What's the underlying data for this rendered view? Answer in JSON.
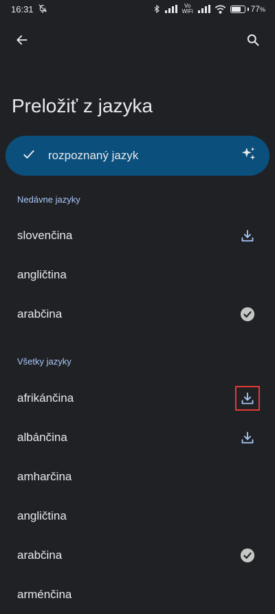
{
  "status": {
    "time": "16:31",
    "battery": "77",
    "battery_unit": "%",
    "battery_level": 0.77,
    "network_label": "Vo WiFi"
  },
  "toolbar": {
    "back_icon": "arrow-back-icon",
    "search_icon": "search-icon"
  },
  "page_title": "Preložiť z jazyka",
  "detected": {
    "label": "rozpoznaný jazyk",
    "check_icon": "check-icon",
    "sparkle_icon": "sparkle-icon"
  },
  "recent": {
    "header": "Nedávne jazyky",
    "items": [
      {
        "name": "slovenčina",
        "status": "download"
      },
      {
        "name": "angličtina",
        "status": "none"
      },
      {
        "name": "arabčina",
        "status": "downloaded"
      }
    ]
  },
  "all": {
    "header": "Všetky jazyky",
    "items": [
      {
        "name": "afrikánčina",
        "status": "download",
        "highlighted": true
      },
      {
        "name": "albánčina",
        "status": "download"
      },
      {
        "name": "amharčina",
        "status": "none"
      },
      {
        "name": "angličtina",
        "status": "none"
      },
      {
        "name": "arabčina",
        "status": "downloaded"
      },
      {
        "name": "arménčina",
        "status": "none"
      }
    ]
  },
  "colors": {
    "background": "#202124",
    "chip": "#0b4f7c",
    "accent": "#a8c7fa",
    "highlight": "#e53935"
  }
}
